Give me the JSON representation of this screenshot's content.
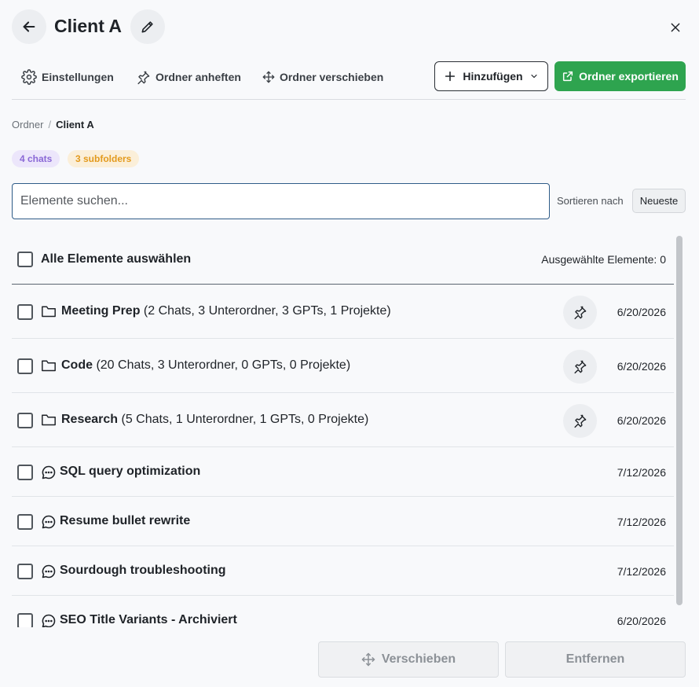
{
  "header": {
    "title": "Client A",
    "back_icon": "arrow-left-icon",
    "edit_icon": "pencil-icon",
    "close_icon": "close-icon"
  },
  "toolbar": {
    "settings_label": "Einstellungen",
    "pin_label": "Ordner anheften",
    "move_label": "Ordner verschieben",
    "add_label": "Hinzufügen",
    "export_label": "Ordner exportieren"
  },
  "breadcrumb": {
    "root": "Ordner",
    "separator": "/",
    "current": "Client A"
  },
  "badges": {
    "chats": "4 chats",
    "subfolders": "3 subfolders"
  },
  "search": {
    "placeholder": "Elemente suchen...",
    "value": ""
  },
  "sort": {
    "label": "Sortieren nach",
    "value": "Neueste"
  },
  "list": {
    "select_all_label": "Alle Elemente auswählen",
    "selected_count": "Ausgewählte Elemente: 0",
    "items": [
      {
        "type": "folder",
        "name": "Meeting Prep",
        "details": " (2 Chats, 3 Unterordner, 3 GPTs, 1 Projekte)",
        "date": "6/20/2026",
        "pinnable": true
      },
      {
        "type": "folder",
        "name": "Code",
        "details": " (20 Chats, 3 Unterordner, 0 GPTs, 0 Projekte)",
        "date": "6/20/2026",
        "pinnable": true
      },
      {
        "type": "folder",
        "name": "Research",
        "details": " (5 Chats, 1 Unterordner, 1 GPTs, 0 Projekte)",
        "date": "6/20/2026",
        "pinnable": true
      },
      {
        "type": "chat",
        "name": "SQL query optimization",
        "details": "",
        "date": "7/12/2026",
        "pinnable": false
      },
      {
        "type": "chat",
        "name": "Resume bullet rewrite",
        "details": "",
        "date": "7/12/2026",
        "pinnable": false
      },
      {
        "type": "chat",
        "name": "Sourdough troubleshooting",
        "details": "",
        "date": "7/12/2026",
        "pinnable": false
      },
      {
        "type": "chat",
        "name": "SEO Title Variants - Archiviert",
        "details": "",
        "date": "6/20/2026",
        "pinnable": false
      }
    ]
  },
  "footer": {
    "move_label": "Verschieben",
    "remove_label": "Entfernen"
  },
  "colors": {
    "accent_green": "#2ea44f",
    "badge_chats": "#8a68d6",
    "badge_subfolders": "#e39a1d"
  }
}
